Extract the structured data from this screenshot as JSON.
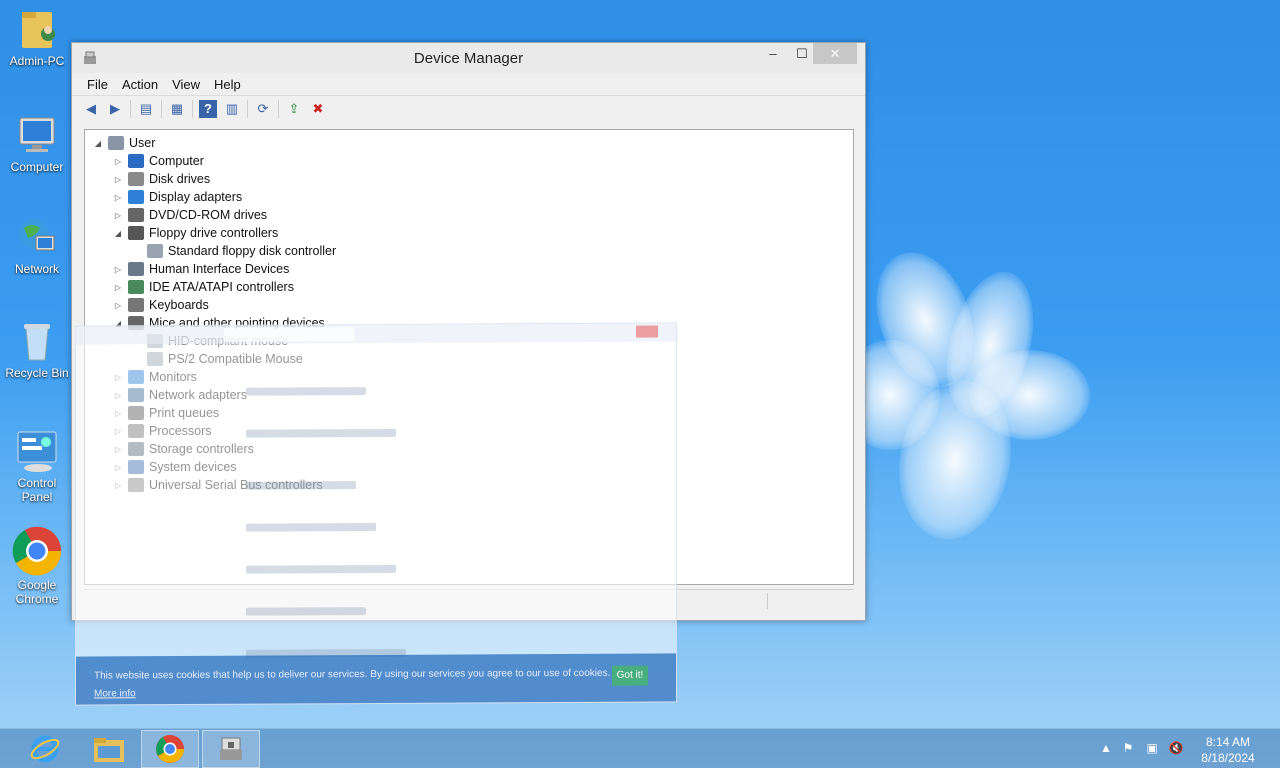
{
  "desktop": {
    "icons": [
      {
        "label": "Admin-PC"
      },
      {
        "label": "Computer"
      },
      {
        "label": "Network"
      },
      {
        "label": "Recycle Bin"
      },
      {
        "label": "Control Panel"
      },
      {
        "label": "Google Chrome"
      }
    ]
  },
  "device_manager": {
    "title": "Device Manager",
    "window_controls": {
      "minimize": "–",
      "maximize": "☐",
      "close": "✕"
    },
    "menu": [
      "File",
      "Action",
      "View",
      "Help"
    ],
    "tree": {
      "root": "User",
      "items": [
        {
          "label": "Computer",
          "expanded": false
        },
        {
          "label": "Disk drives",
          "expanded": false
        },
        {
          "label": "Display adapters",
          "expanded": false
        },
        {
          "label": "DVD/CD-ROM drives",
          "expanded": false
        },
        {
          "label": "Floppy drive controllers",
          "expanded": true,
          "children": [
            "Standard floppy disk controller"
          ]
        },
        {
          "label": "Human Interface Devices",
          "expanded": false
        },
        {
          "label": "IDE ATA/ATAPI controllers",
          "expanded": false
        },
        {
          "label": "Keyboards",
          "expanded": false
        },
        {
          "label": "Mice and other pointing devices",
          "expanded": true,
          "children": [
            "HID-compliant mouse",
            "PS/2 Compatible Mouse"
          ]
        },
        {
          "label": "Monitors",
          "expanded": false
        },
        {
          "label": "Network adapters",
          "expanded": false
        },
        {
          "label": "Print queues",
          "expanded": false
        },
        {
          "label": "Processors",
          "expanded": false
        },
        {
          "label": "Storage controllers",
          "expanded": false
        },
        {
          "label": "System devices",
          "expanded": false
        },
        {
          "label": "Universal Serial Bus controllers",
          "expanded": false
        }
      ]
    }
  },
  "ghost_browser": {
    "cookie_message": "This website uses cookies that help us to deliver our services. By using our services you agree to our use of cookies.",
    "more_info": "More info",
    "got_it": "Got it!"
  },
  "taskbar": {
    "clock_time": "8:14 AM",
    "clock_date": "8/18/2024"
  }
}
